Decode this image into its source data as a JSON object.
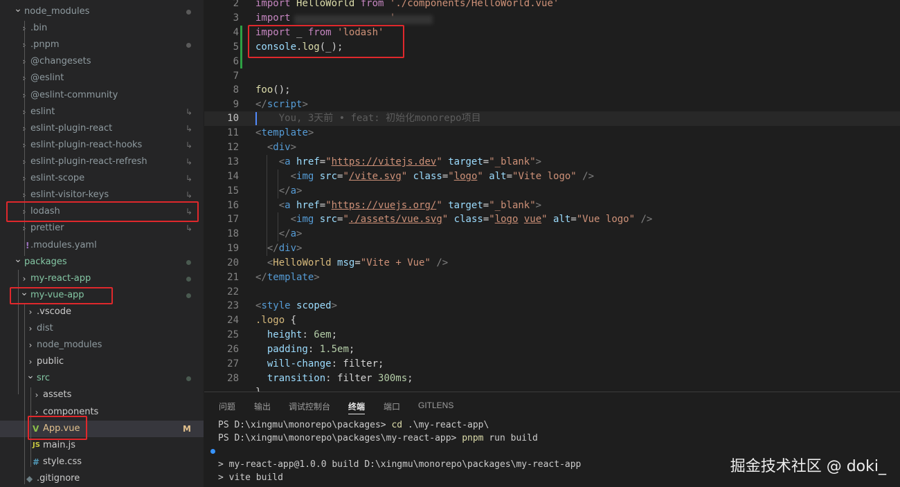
{
  "explorer": {
    "items": [
      {
        "label": "node_modules",
        "kind": "folder-open",
        "deco": "dot"
      },
      {
        "label": ".bin",
        "kind": "folder",
        "deco": ""
      },
      {
        "label": ".pnpm",
        "kind": "folder",
        "deco": "dot"
      },
      {
        "label": "@changesets",
        "kind": "folder",
        "deco": ""
      },
      {
        "label": "@eslint",
        "kind": "folder",
        "deco": ""
      },
      {
        "label": "@eslint-community",
        "kind": "folder",
        "deco": ""
      },
      {
        "label": "eslint",
        "kind": "folder",
        "deco": "link"
      },
      {
        "label": "eslint-plugin-react",
        "kind": "folder",
        "deco": "link"
      },
      {
        "label": "eslint-plugin-react-hooks",
        "kind": "folder",
        "deco": "link"
      },
      {
        "label": "eslint-plugin-react-refresh",
        "kind": "folder",
        "deco": "link"
      },
      {
        "label": "eslint-scope",
        "kind": "folder",
        "deco": "link"
      },
      {
        "label": "eslint-visitor-keys",
        "kind": "folder",
        "deco": "link"
      },
      {
        "label": "lodash",
        "kind": "folder",
        "deco": "link"
      },
      {
        "label": "prettier",
        "kind": "folder",
        "deco": "link"
      },
      {
        "label": ".modules.yaml",
        "kind": "yaml",
        "deco": ""
      },
      {
        "label": "packages",
        "kind": "folder-open",
        "deco": "dot"
      },
      {
        "label": "my-react-app",
        "kind": "folder",
        "deco": "dot"
      },
      {
        "label": "my-vue-app",
        "kind": "folder-open",
        "deco": "dot"
      },
      {
        "label": ".vscode",
        "kind": "folder",
        "deco": ""
      },
      {
        "label": "dist",
        "kind": "folder",
        "deco": ""
      },
      {
        "label": "node_modules",
        "kind": "folder",
        "deco": ""
      },
      {
        "label": "public",
        "kind": "folder",
        "deco": ""
      },
      {
        "label": "src",
        "kind": "folder-open",
        "deco": "dot"
      },
      {
        "label": "assets",
        "kind": "folder",
        "deco": ""
      },
      {
        "label": "components",
        "kind": "folder",
        "deco": ""
      },
      {
        "label": "App.vue",
        "kind": "vue",
        "deco": "M"
      },
      {
        "label": "main.js",
        "kind": "js",
        "deco": ""
      },
      {
        "label": "style.css",
        "kind": "css",
        "deco": ""
      },
      {
        "label": ".gitignore",
        "kind": "git",
        "deco": ""
      }
    ],
    "icons": {
      "js": "JS",
      "css": "#",
      "yaml": "!",
      "vue": "V",
      "git": "◆"
    },
    "decos": {
      "link": "↳",
      "M": "M"
    }
  },
  "editor": {
    "lines": [
      {
        "n": "2",
        "tokens": [
          [
            "kw",
            "import"
          ],
          [
            "plain",
            " "
          ],
          [
            "fn",
            "HelloWorld"
          ],
          [
            "plain",
            " "
          ],
          [
            "kw",
            "from"
          ],
          [
            "plain",
            " "
          ],
          [
            "str",
            "'./components/HelloWorld.vue'"
          ]
        ]
      },
      {
        "n": "3",
        "tokens": [
          [
            "kw",
            "import"
          ],
          [
            "plain",
            "                 "
          ],
          [
            "str",
            "'"
          ]
        ]
      },
      {
        "n": "4",
        "tokens": [
          [
            "kw",
            "import"
          ],
          [
            "plain",
            " _ "
          ],
          [
            "kw",
            "from"
          ],
          [
            "plain",
            " "
          ],
          [
            "str",
            "'lodash'"
          ]
        ]
      },
      {
        "n": "5",
        "tokens": [
          [
            "attr",
            "console"
          ],
          [
            "plain",
            "."
          ],
          [
            "fn",
            "log"
          ],
          [
            "plain",
            "(_);"
          ]
        ]
      },
      {
        "n": "6",
        "tokens": []
      },
      {
        "n": "7",
        "tokens": []
      },
      {
        "n": "8",
        "tokens": [
          [
            "fn",
            "foo"
          ],
          [
            "plain",
            "();"
          ]
        ]
      },
      {
        "n": "9",
        "tokens": [
          [
            "tagb",
            "</"
          ],
          [
            "tag",
            "script"
          ],
          [
            "tagb",
            ">"
          ]
        ]
      },
      {
        "n": "10",
        "tokens": [
          [
            "blame",
            "    You, 3天前 • feat: 初始化monorepo项目"
          ]
        ]
      },
      {
        "n": "11",
        "tokens": [
          [
            "tagb",
            "<"
          ],
          [
            "tag",
            "template"
          ],
          [
            "tagb",
            ">"
          ]
        ]
      },
      {
        "n": "12",
        "tokens": [
          [
            "plain",
            "  "
          ],
          [
            "tagb",
            "<"
          ],
          [
            "tag",
            "div"
          ],
          [
            "tagb",
            ">"
          ]
        ]
      },
      {
        "n": "13",
        "tokens": [
          [
            "plain",
            "    "
          ],
          [
            "tagb",
            "<"
          ],
          [
            "tag",
            "a"
          ],
          [
            "plain",
            " "
          ],
          [
            "attr",
            "href"
          ],
          [
            "plain",
            "="
          ],
          [
            "val",
            "\""
          ],
          [
            "url",
            "https://vitejs.dev"
          ],
          [
            "val",
            "\""
          ],
          [
            "plain",
            " "
          ],
          [
            "attr",
            "target"
          ],
          [
            "plain",
            "="
          ],
          [
            "val",
            "\"_blank\""
          ],
          [
            "tagb",
            ">"
          ]
        ]
      },
      {
        "n": "14",
        "tokens": [
          [
            "plain",
            "      "
          ],
          [
            "tagb",
            "<"
          ],
          [
            "tag",
            "img"
          ],
          [
            "plain",
            " "
          ],
          [
            "attr",
            "src"
          ],
          [
            "plain",
            "="
          ],
          [
            "val",
            "\""
          ],
          [
            "url",
            "/vite.svg"
          ],
          [
            "val",
            "\""
          ],
          [
            "plain",
            " "
          ],
          [
            "attr",
            "class"
          ],
          [
            "plain",
            "="
          ],
          [
            "val",
            "\""
          ],
          [
            "url",
            "logo"
          ],
          [
            "val",
            "\""
          ],
          [
            "plain",
            " "
          ],
          [
            "attr",
            "alt"
          ],
          [
            "plain",
            "="
          ],
          [
            "val",
            "\"Vite logo\""
          ],
          [
            "plain",
            " "
          ],
          [
            "tagb",
            "/>"
          ]
        ]
      },
      {
        "n": "15",
        "tokens": [
          [
            "plain",
            "    "
          ],
          [
            "tagb",
            "</"
          ],
          [
            "tag",
            "a"
          ],
          [
            "tagb",
            ">"
          ]
        ]
      },
      {
        "n": "16",
        "tokens": [
          [
            "plain",
            "    "
          ],
          [
            "tagb",
            "<"
          ],
          [
            "tag",
            "a"
          ],
          [
            "plain",
            " "
          ],
          [
            "attr",
            "href"
          ],
          [
            "plain",
            "="
          ],
          [
            "val",
            "\""
          ],
          [
            "url",
            "https://vuejs.org/"
          ],
          [
            "val",
            "\""
          ],
          [
            "plain",
            " "
          ],
          [
            "attr",
            "target"
          ],
          [
            "plain",
            "="
          ],
          [
            "val",
            "\"_blank\""
          ],
          [
            "tagb",
            ">"
          ]
        ]
      },
      {
        "n": "17",
        "tokens": [
          [
            "plain",
            "      "
          ],
          [
            "tagb",
            "<"
          ],
          [
            "tag",
            "img"
          ],
          [
            "plain",
            " "
          ],
          [
            "attr",
            "src"
          ],
          [
            "plain",
            "="
          ],
          [
            "val",
            "\""
          ],
          [
            "url",
            "./assets/vue.svg"
          ],
          [
            "val",
            "\""
          ],
          [
            "plain",
            " "
          ],
          [
            "attr",
            "class"
          ],
          [
            "plain",
            "="
          ],
          [
            "val",
            "\""
          ],
          [
            "url",
            "logo"
          ],
          [
            "val",
            " "
          ],
          [
            "url",
            "vue"
          ],
          [
            "val",
            "\""
          ],
          [
            "plain",
            " "
          ],
          [
            "attr",
            "alt"
          ],
          [
            "plain",
            "="
          ],
          [
            "val",
            "\"Vue logo\""
          ],
          [
            "plain",
            " "
          ],
          [
            "tagb",
            "/>"
          ]
        ]
      },
      {
        "n": "18",
        "tokens": [
          [
            "plain",
            "    "
          ],
          [
            "tagb",
            "</"
          ],
          [
            "tag",
            "a"
          ],
          [
            "tagb",
            ">"
          ]
        ]
      },
      {
        "n": "19",
        "tokens": [
          [
            "plain",
            "  "
          ],
          [
            "tagb",
            "</"
          ],
          [
            "tag",
            "div"
          ],
          [
            "tagb",
            ">"
          ]
        ]
      },
      {
        "n": "20",
        "tokens": [
          [
            "plain",
            "  "
          ],
          [
            "tagb",
            "<"
          ],
          [
            "sel-c",
            "HelloWorld"
          ],
          [
            "plain",
            " "
          ],
          [
            "attr",
            "msg"
          ],
          [
            "plain",
            "="
          ],
          [
            "val",
            "\"Vite + Vue\""
          ],
          [
            "plain",
            " "
          ],
          [
            "tagb",
            "/>"
          ]
        ]
      },
      {
        "n": "21",
        "tokens": [
          [
            "tagb",
            "</"
          ],
          [
            "tag",
            "template"
          ],
          [
            "tagb",
            ">"
          ]
        ]
      },
      {
        "n": "22",
        "tokens": []
      },
      {
        "n": "23",
        "tokens": [
          [
            "tagb",
            "<"
          ],
          [
            "tag",
            "style"
          ],
          [
            "plain",
            " "
          ],
          [
            "attr",
            "scoped"
          ],
          [
            "tagb",
            ">"
          ]
        ]
      },
      {
        "n": "24",
        "tokens": [
          [
            "sel-c",
            ".logo"
          ],
          [
            "plain",
            " {"
          ]
        ]
      },
      {
        "n": "25",
        "tokens": [
          [
            "plain",
            "  "
          ],
          [
            "prop",
            "height"
          ],
          [
            "plain",
            ": "
          ],
          [
            "num",
            "6em"
          ],
          [
            "plain",
            ";"
          ]
        ]
      },
      {
        "n": "26",
        "tokens": [
          [
            "plain",
            "  "
          ],
          [
            "prop",
            "padding"
          ],
          [
            "plain",
            ": "
          ],
          [
            "num",
            "1.5em"
          ],
          [
            "plain",
            ";"
          ]
        ]
      },
      {
        "n": "27",
        "tokens": [
          [
            "plain",
            "  "
          ],
          [
            "prop",
            "will-change"
          ],
          [
            "plain",
            ": filter;"
          ]
        ]
      },
      {
        "n": "28",
        "tokens": [
          [
            "plain",
            "  "
          ],
          [
            "prop",
            "transition"
          ],
          [
            "plain",
            ": filter "
          ],
          [
            "num",
            "300ms"
          ],
          [
            "plain",
            ";"
          ]
        ]
      },
      {
        "n": "",
        "tokens": [
          [
            "plain",
            "}"
          ]
        ]
      }
    ]
  },
  "panel": {
    "tabs": [
      "问题",
      "输出",
      "调试控制台",
      "终端",
      "端口",
      "GITLENS"
    ],
    "active_tab": "终端",
    "terminal": [
      {
        "prompt": "PS D:\\xingmu\\monorepo\\packages> ",
        "cmd": "cd",
        "rest": " .\\my-react-app\\"
      },
      {
        "prompt": "PS D:\\xingmu\\monorepo\\packages\\my-react-app> ",
        "cmd": "pnpm",
        "rest": " run build"
      },
      {
        "prompt": "",
        "cmd": "",
        "rest": ""
      },
      {
        "prompt": "> my-react-app@1.0.0 build D:\\xingmu\\monorepo\\packages\\my-react-app",
        "cmd": "",
        "rest": ""
      },
      {
        "prompt": "> vite build",
        "cmd": "",
        "rest": ""
      }
    ]
  },
  "watermark": "掘金技术社区 @ doki_",
  "colors": {
    "highlight_box": "#e0282c",
    "git_added": "#2ea043",
    "modified": "#e2c08d"
  }
}
